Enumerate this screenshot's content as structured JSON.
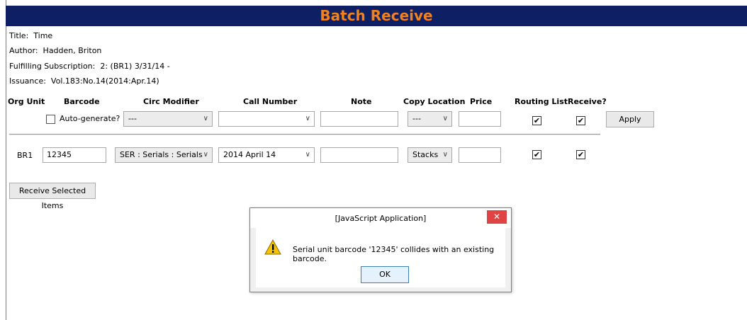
{
  "window": {
    "title": "Batch Receive"
  },
  "info": {
    "title_label": "Title:",
    "title_value": "Time",
    "author_label": "Author:",
    "author_value": "Hadden, Briton",
    "subscription_label": "Fulfilling Subscription:",
    "subscription_value": "2: (BR1) 3/31/14 -",
    "issuance_label": "Issuance:",
    "issuance_value": "Vol.183:No.14(2014:Apr.14)"
  },
  "columns": {
    "org_unit": "Org Unit",
    "barcode": "Barcode",
    "circ_modifier": "Circ Modifier",
    "call_number": "Call Number",
    "note": "Note",
    "copy_location": "Copy Location",
    "price": "Price",
    "routing_list": "Routing List",
    "receive": "Receive?"
  },
  "defaults_row": {
    "auto_generate_label": "Auto-generate?",
    "auto_generate_checked": false,
    "circ_modifier": "---",
    "call_number": "",
    "note": "",
    "copy_location": "---",
    "price": "",
    "routing_list_checked": true,
    "receive_checked": true,
    "apply_label": "Apply"
  },
  "item_row": {
    "org_unit": "BR1",
    "barcode": "12345",
    "circ_modifier": "SER : Serials : Serials",
    "call_number": "2014 April 14",
    "note": "",
    "copy_location": "Stacks",
    "price": "",
    "routing_list_checked": true,
    "receive_checked": true
  },
  "receive_selected_label": "Receive Selected Items",
  "dialog": {
    "title": "[JavaScript Application]",
    "close_label": "✕",
    "message": "Serial unit barcode '12345' collides with an existing barcode.",
    "ok_label": "OK",
    "icon": "warning-icon"
  },
  "glyphs": {
    "chevron": "∨",
    "check": "✔"
  },
  "colors": {
    "titlebar_bg": "#0f1f63",
    "titlebar_text": "#f2811d",
    "close_button": "#e04343"
  }
}
